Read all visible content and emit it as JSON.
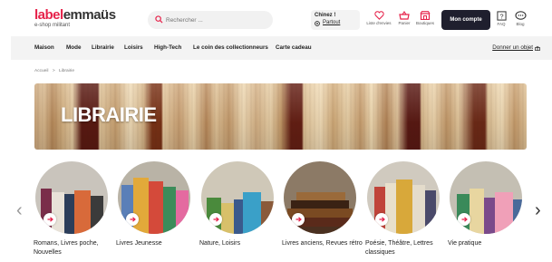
{
  "header": {
    "logo_part1": "label",
    "logo_part2": "emmaüs",
    "logo_tagline": "e-shop militant",
    "search_placeholder": "Rechercher ...",
    "chinez_title": "Chinez !",
    "chinez_location": "Partout",
    "icons": [
      {
        "name": "heart-icon",
        "label": "Liste d'envies"
      },
      {
        "name": "basket-icon",
        "label": "Panier"
      },
      {
        "name": "shop-icon",
        "label": "Boutiques"
      }
    ],
    "account_label": "Mon compte",
    "faq_label": "FAQ",
    "blog_label": "Blog"
  },
  "nav": {
    "items": [
      "Maison",
      "Mode",
      "Librairie",
      "Loisirs",
      "High-Tech",
      "Le coin des collectionneurs",
      "Carte cadeau"
    ],
    "give_label": "Donner un objet"
  },
  "breadcrumb": {
    "home": "Accueil",
    "separator": ">",
    "current": "Librairie"
  },
  "banner": {
    "title": "LIBRAIRIE"
  },
  "categories": [
    {
      "label": "Romans, Livres poche, Nouvelles"
    },
    {
      "label": "Livres Jeunesse"
    },
    {
      "label": "Nature, Loisirs"
    },
    {
      "label": "Livres anciens, Revues rétro"
    },
    {
      "label": "Poésie, Théâtre, Lettres classiques"
    },
    {
      "label": "Vie pratique"
    }
  ],
  "colors": {
    "brand_red": "#e6224a",
    "dark_button": "#1f1f2e",
    "nav_bg": "#f3f3f3"
  }
}
